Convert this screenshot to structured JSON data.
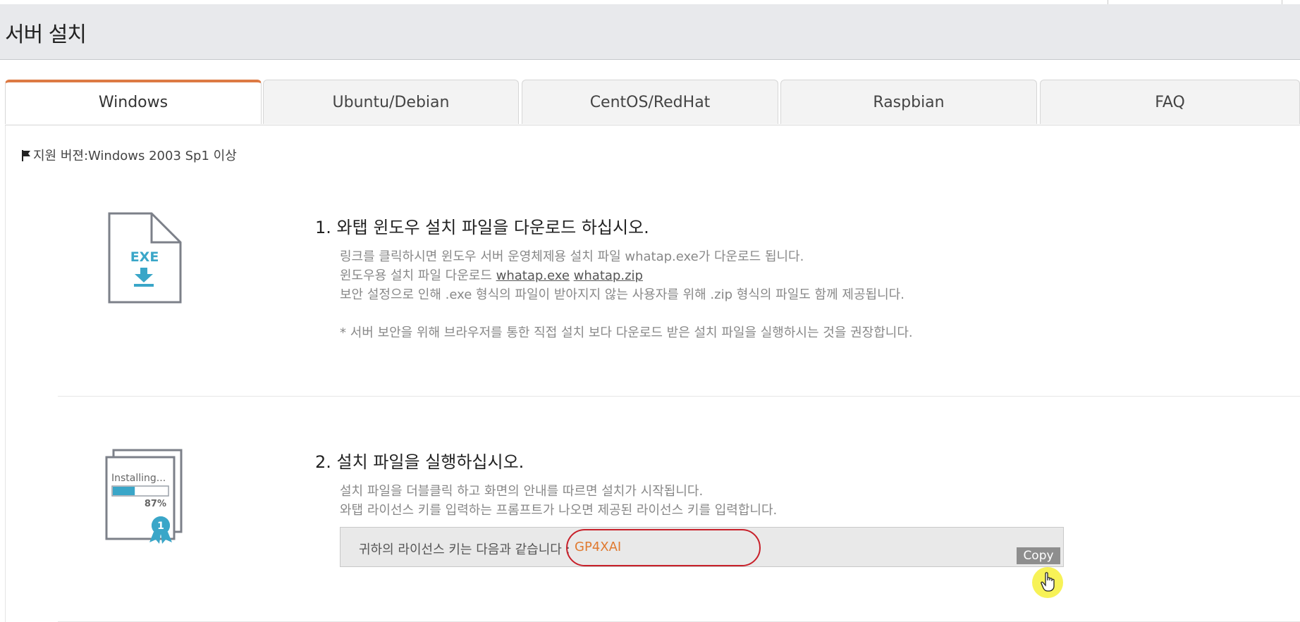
{
  "page": {
    "title": "서버 설치"
  },
  "tabs": [
    {
      "label": "Windows",
      "active": true
    },
    {
      "label": "Ubuntu/Debian",
      "active": false
    },
    {
      "label": "CentOS/RedHat",
      "active": false
    },
    {
      "label": "Raspbian",
      "active": false
    },
    {
      "label": "FAQ",
      "active": false
    }
  ],
  "support": {
    "text": "지원 버젼:Windows 2003 Sp1 이상",
    "icon": "flag-icon"
  },
  "step1": {
    "icon": "exe-file-download-icon",
    "icon_text": "EXE",
    "title": "1. 와탭 윈도우 설치 파일을 다운로드 하십시오.",
    "line1": "링크를 클릭하시면 윈도우 서버 운영체제용 설치 파일 whatap.exe가 다운로드 됩니다.",
    "line2_prefix": "윈도우용 설치 파일 다운로드 ",
    "link_exe": "whatap.exe",
    "link_zip": "whatap.zip",
    "line3": "보안 설정으로 인해 .exe 형식의 파일이 받아지지 않는 사용자를 위해 .zip 형식의 파일도 함께 제공됩니다.",
    "note": "* 서버 보안을 위해 브라우저를 통한 직접 설치 보다 다운로드 받은 설치 파일을 실행하시는 것을 권장합니다."
  },
  "step2": {
    "icon": "installing-progress-icon",
    "icon_text": "Installing...",
    "icon_percent_text": "87%",
    "icon_progress": 0.4,
    "icon_badge": "1",
    "title": "2. 설치 파일을 실행하십시오.",
    "line1": "설치 파일을 더블클릭 하고 화면의 안내를 따르면 설치가 시작됩니다.",
    "line2": "와탭 라이선스 키를 입력하는 프롬프트가 나오면 제공된 라이선스 키를 입력합니다.",
    "license_label": "귀하의 라이선스 키는 다음과 같습니다 : ",
    "license_key": "GP4XAI",
    "copy_label": "Copy"
  },
  "colors": {
    "active_tab_accent": "#dd7a44",
    "license_key": "#e07a30",
    "highlight_oval": "#c8202a",
    "icon_teal": "#3aa6c8",
    "cursor_highlight": "#f6f03a"
  }
}
